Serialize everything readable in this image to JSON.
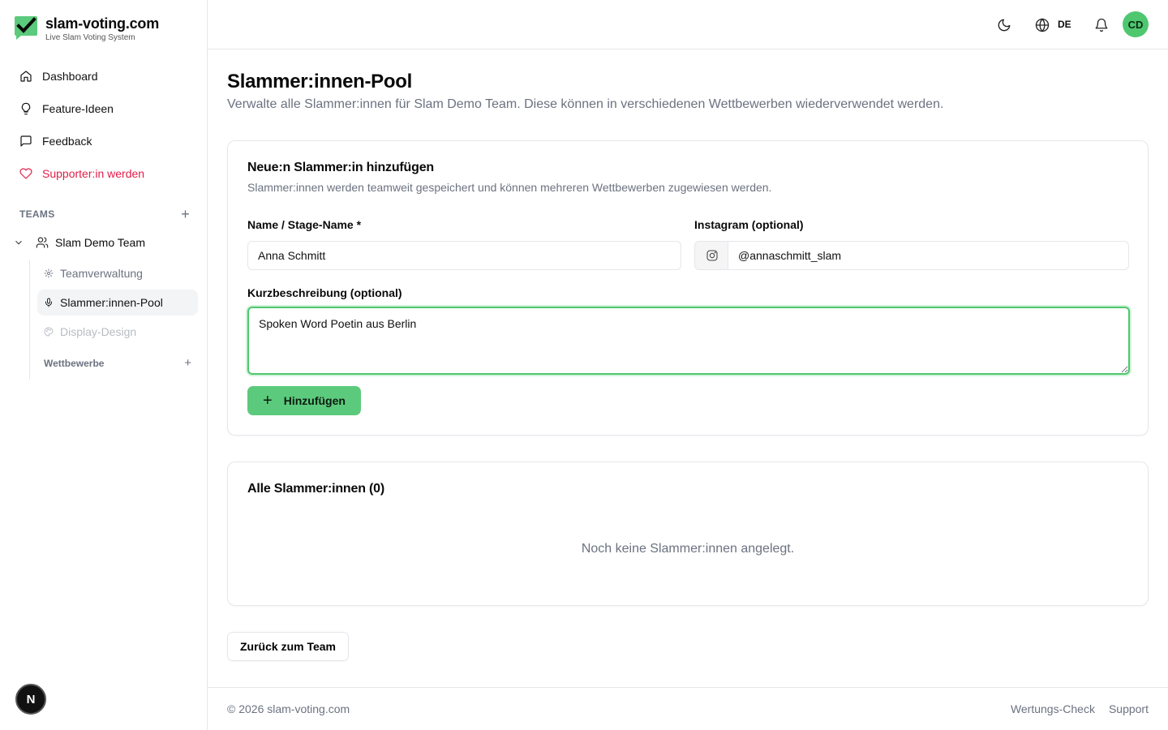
{
  "brand": {
    "title": "slam-voting.com",
    "subtitle": "Live Slam Voting System",
    "logo_icon": "checkmark-logo-icon",
    "accent": "#4fc76f"
  },
  "nav": [
    {
      "label": "Dashboard",
      "icon": "home-icon"
    },
    {
      "label": "Feature-Ideen",
      "icon": "lightbulb-icon"
    },
    {
      "label": "Feedback",
      "icon": "message-square-icon"
    },
    {
      "label": "Supporter:in werden",
      "icon": "heart-icon",
      "color": "#e11d48"
    }
  ],
  "teams": {
    "heading": "TEAMS",
    "team_name": "Slam Demo Team",
    "sub_items": [
      {
        "label": "Teamverwaltung",
        "icon": "gear-icon"
      },
      {
        "label": "Slammer:innen-Pool",
        "icon": "microphone-icon",
        "active": true
      },
      {
        "label": "Display-Design",
        "icon": "palette-icon",
        "disabled": true
      }
    ],
    "competitions_heading": "Wettbewerbe"
  },
  "topbar": {
    "language": "DE",
    "avatar_initials": "CD",
    "icons": [
      "moon-icon",
      "globe-icon",
      "bell-icon"
    ]
  },
  "page": {
    "title": "Slammer:innen-Pool",
    "description": "Verwalte alle Slammer:innen für Slam Demo Team. Diese können in verschiedenen Wettbewerben wiederverwendet werden."
  },
  "add_form": {
    "title": "Neue:n Slammer:in hinzufügen",
    "description": "Slammer:innen werden teamweit gespeichert und können mehreren Wettbewerben zugewiesen werden.",
    "name_label": "Name / Stage-Name *",
    "name_value": "Anna Schmitt",
    "instagram_label": "Instagram (optional)",
    "instagram_value": "@annaschmitt_slam",
    "bio_label": "Kurzbeschreibung (optional)",
    "bio_value": "Spoken Word Poetin aus Berlin",
    "submit_label": "Hinzufügen"
  },
  "list": {
    "title": "Alle Slammer:innen (0)",
    "empty_text": "Noch keine Slammer:innen angelegt."
  },
  "back_label": "Zurück zum Team",
  "footer": {
    "copyright": "© 2026 slam-voting.com",
    "links": [
      "Wertungs-Check",
      "Support"
    ]
  },
  "dev_badge": "N"
}
